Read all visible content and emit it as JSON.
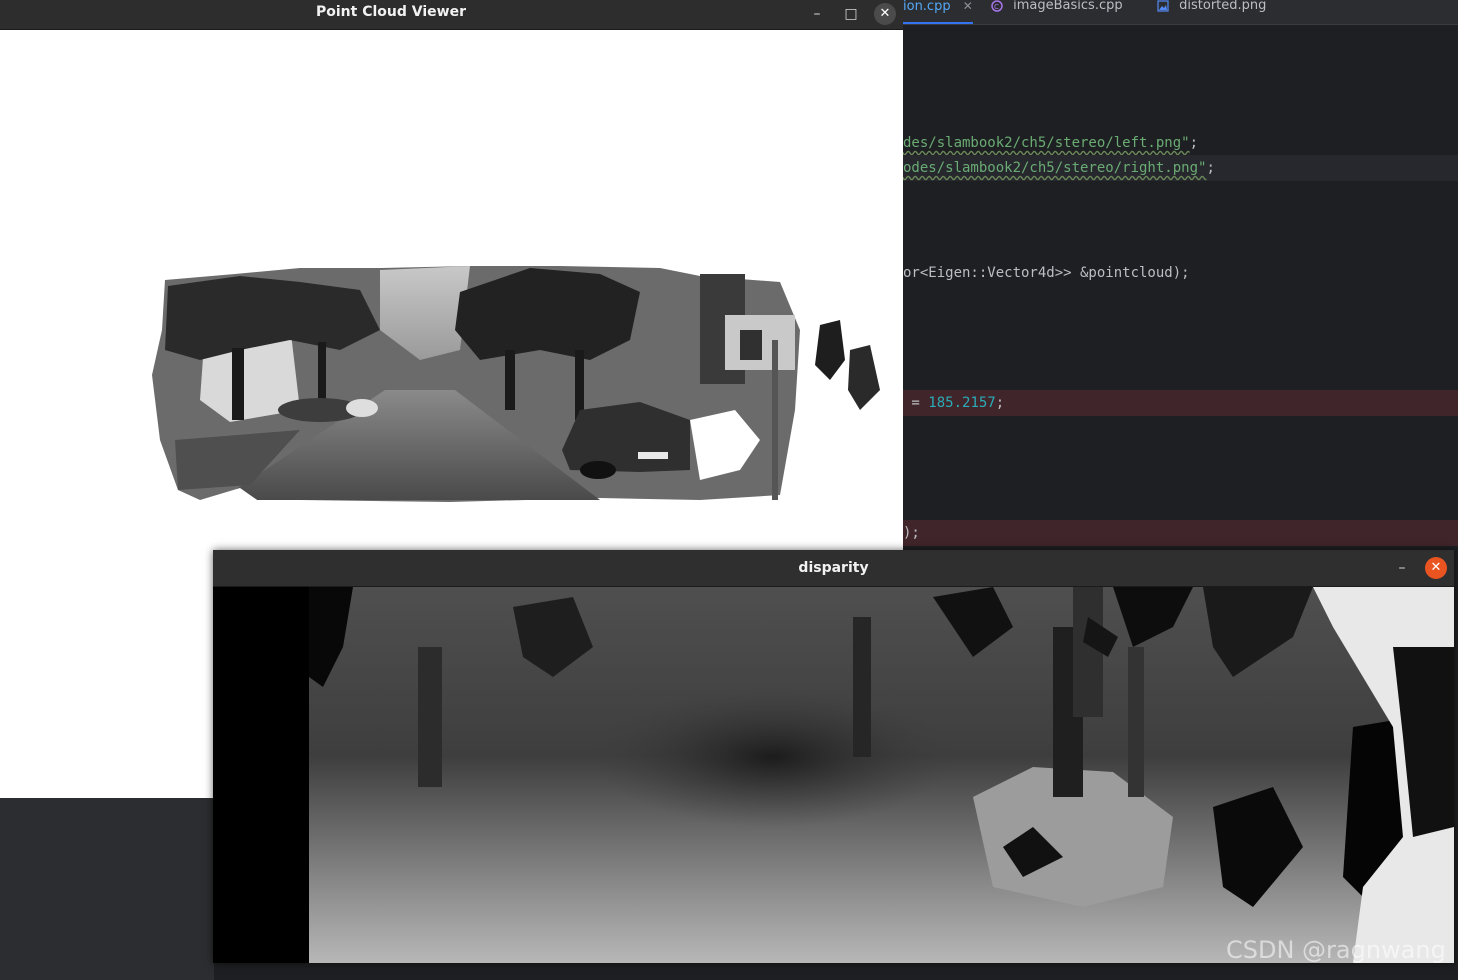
{
  "editor": {
    "tabs": [
      {
        "label": "ion.cpp",
        "active": true,
        "closable": true,
        "icon": "cpp-file-icon"
      },
      {
        "label": "imageBasics.cpp",
        "active": false,
        "closable": false,
        "icon": "cpp-file-icon"
      },
      {
        "label": "distorted.png",
        "active": false,
        "closable": false,
        "icon": "image-file-icon"
      }
    ],
    "code": {
      "line_left_path": "des/slambook2/ch5/stereo/left.png\"",
      "line_left_end": ";",
      "line_right_path": "odes/slambook2/ch5/stereo/right.png\"",
      "line_right_end": ";",
      "line_vector": "or<Eigen::Vector4d>> &pointcloud);",
      "line_assign_op": " = ",
      "line_assign_value": "185.2157",
      "line_assign_end": ";",
      "line_paren": ");"
    }
  },
  "point_cloud_viewer": {
    "title": "Point Cloud Viewer",
    "minimize_glyph": "–",
    "maximize_glyph": "□",
    "close_glyph": "✕"
  },
  "disparity_window": {
    "title": "disparity",
    "minimize_glyph": "–",
    "close_glyph": "✕"
  },
  "watermark": "CSDN @ragnwang",
  "colors": {
    "accent_tab": "#56a8f5",
    "string": "#6aab73",
    "number": "#2aacb8",
    "breakpoint_line": "#40252a",
    "ubuntu_close": "#e95420"
  }
}
